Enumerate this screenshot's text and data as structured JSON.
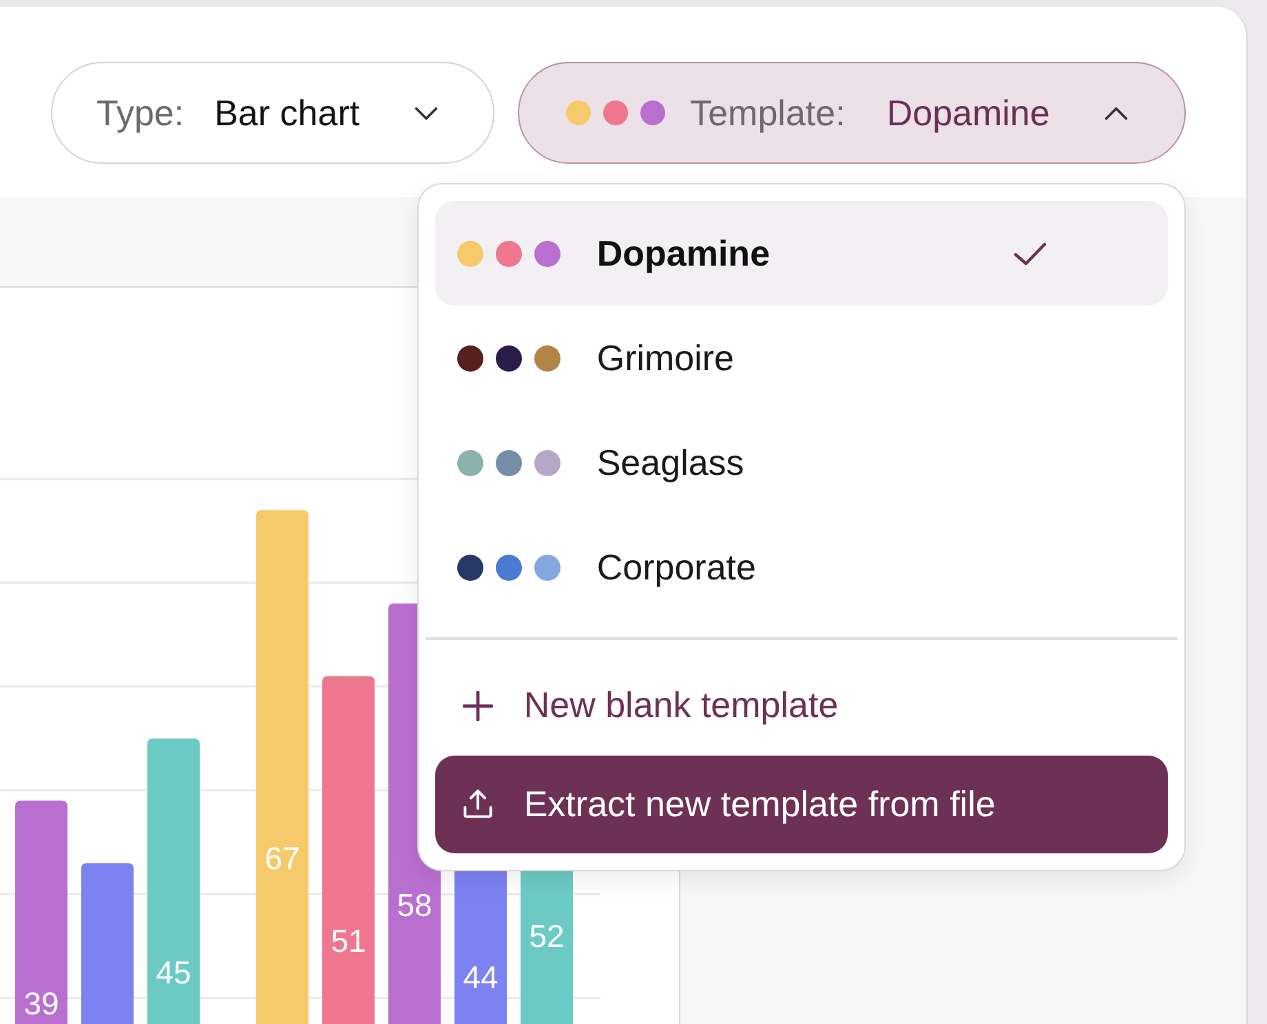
{
  "toolbar": {
    "type_select": {
      "label": "Type:",
      "value": "Bar chart",
      "expanded": false
    },
    "template_select": {
      "label": "Template:",
      "value": "Dopamine",
      "expanded": true,
      "swatches": [
        {
          "color": "#f6ca6b"
        },
        {
          "color": "#ee778f"
        },
        {
          "color": "#b96fd0"
        }
      ]
    }
  },
  "template_menu": {
    "templates": [
      {
        "name": "Dopamine",
        "selected": true,
        "swatches": [
          {
            "color": "#f6ca6b"
          },
          {
            "color": "#ee778f"
          },
          {
            "color": "#b96fd0"
          }
        ]
      },
      {
        "name": "Grimoire",
        "selected": false,
        "swatches": [
          {
            "color": "#55201f"
          },
          {
            "color": "#2c1c4a"
          },
          {
            "color": "#b08545"
          }
        ]
      },
      {
        "name": "Seaglass",
        "selected": false,
        "swatches": [
          {
            "color": "#8bb2ad"
          },
          {
            "color": "#748da8"
          },
          {
            "color": "#b6a7c9"
          }
        ]
      },
      {
        "name": "Corporate",
        "selected": false,
        "swatches": [
          {
            "color": "#273966"
          },
          {
            "color": "#4a7bd1"
          },
          {
            "color": "#84a7e0"
          }
        ]
      }
    ],
    "actions": [
      {
        "kind": "add",
        "label": "New blank template",
        "highlighted": false
      },
      {
        "kind": "upload",
        "label": "Extract new template from file",
        "highlighted": true
      }
    ]
  },
  "chart": {
    "bar_groups": [
      {
        "bars": [
          {
            "color": "#b96fd0",
            "label": "39"
          },
          {
            "color": "#7d82f3"
          },
          {
            "color": "#6ccac4",
            "label": "45"
          }
        ]
      },
      {
        "bars": [
          {
            "color": "#f6ca6b",
            "label": "67"
          },
          {
            "color": "#ee778f",
            "label": "51"
          },
          {
            "color": "#b96fd0",
            "label": "58"
          },
          {
            "color": "#7d82f3",
            "label": "44"
          },
          {
            "color": "#6ccac4",
            "label": "52"
          }
        ]
      }
    ]
  }
}
